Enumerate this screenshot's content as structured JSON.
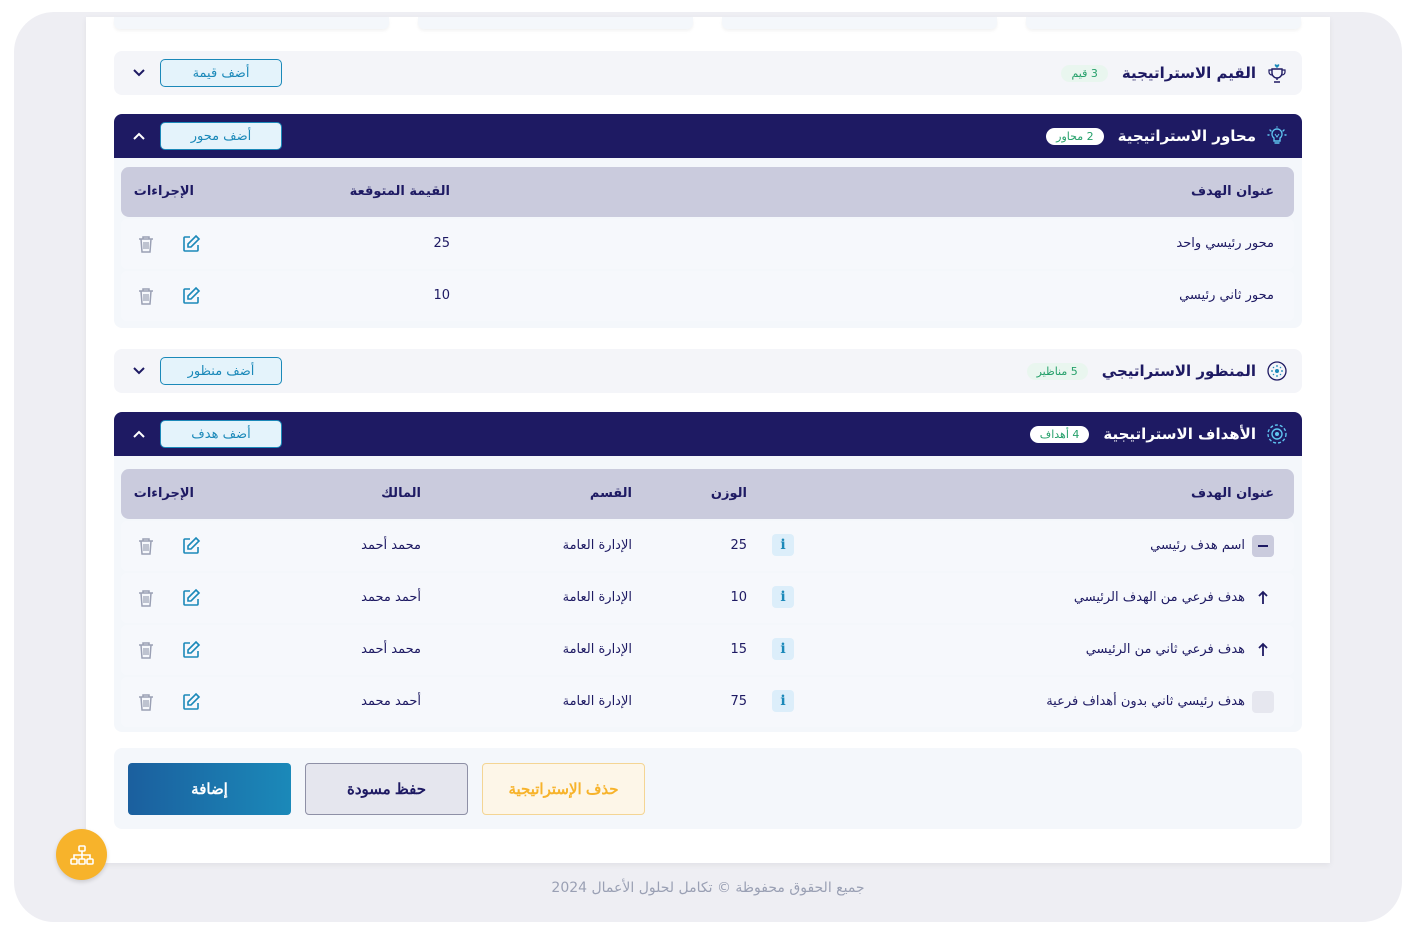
{
  "sections": {
    "values": {
      "title": "القيم الاستراتيجية",
      "badge": "3 قيم",
      "add_label": "أضف قيمة"
    },
    "axes": {
      "title": "محاور الاستراتيجية",
      "badge": "2 محاور",
      "add_label": "أضف محور",
      "headers": {
        "title": "عنوان الهدف",
        "expected": "القيمة المتوقعة",
        "actions": "الإجراءات"
      },
      "rows": [
        {
          "title": "محور رئيسي واحد",
          "expected": "25"
        },
        {
          "title": "محور ثاني رئيسي",
          "expected": "10"
        }
      ]
    },
    "perspectives": {
      "title": "المنظور الاستراتيجي",
      "badge": "5 مناظير",
      "add_label": "أضف منظور"
    },
    "goals": {
      "title": "الأهداف الاستراتيجية",
      "badge": "4 أهداف",
      "add_label": "أضف هدف",
      "headers": {
        "title": "عنوان الهدف",
        "weight": "الوزن",
        "department": "القسم",
        "owner": "المالك",
        "actions": "الإجراءات"
      },
      "rows": [
        {
          "title": "اسم هدف رئيسي",
          "weight": "25",
          "department": "الإدارة العامة",
          "owner": "محمد أحمد",
          "marker": "collapse"
        },
        {
          "title": "هدف فرعي من الهدف الرئيسي",
          "weight": "10",
          "department": "الإدارة العامة",
          "owner": "أحمد محمد",
          "marker": "sub"
        },
        {
          "title": "هدف فرعي ثاني من الرئيسي",
          "weight": "15",
          "department": "الإدارة العامة",
          "owner": "محمد أحمد",
          "marker": "sub"
        },
        {
          "title": "هدف رئيسي ثاني بدون أهداف فرعية",
          "weight": "75",
          "department": "الإدارة العامة",
          "owner": "أحمد محمد",
          "marker": "empty"
        }
      ],
      "info_label": "i"
    }
  },
  "buttons": {
    "add": "إضافة",
    "draft": "حفظ مسودة",
    "delete": "حذف الإستراتيجية"
  },
  "footer": {
    "copyright": "جميع الحقوق محفوظة © تكامل لحلول الأعمال 2024"
  },
  "colors": {
    "navy": "#1e1a63",
    "accent": "#1b89b9",
    "warning": "#f7b32b",
    "success": "#25a06a"
  }
}
